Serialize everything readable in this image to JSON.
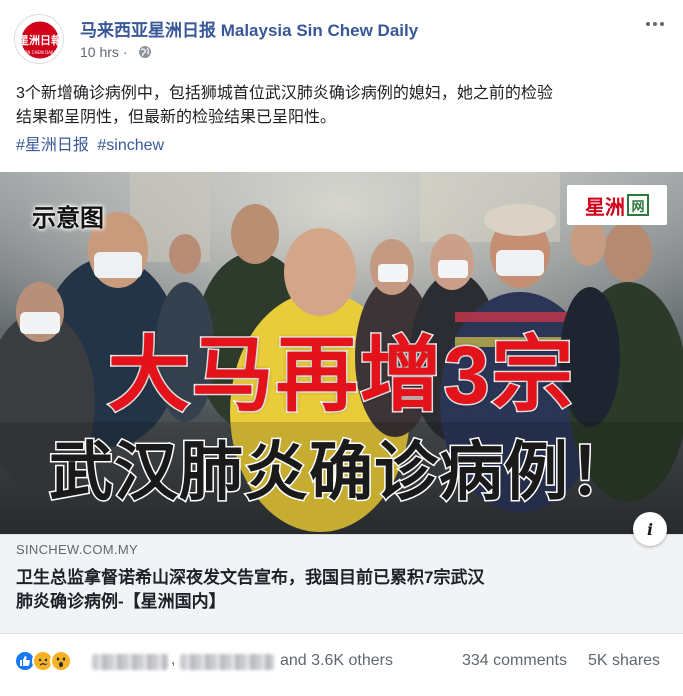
{
  "post": {
    "page_name": "马来西亚星洲日报 Malaysia Sin Chew Daily",
    "time": "10 hrs",
    "separator": "·",
    "text_line1": "3个新增确诊病例中，包括狮城首位武汉肺炎确诊病例的媳妇，她之前的检验",
    "text_line2": "结果都呈阴性，但最新的检验结果已呈阳性。",
    "hashtags": [
      "#星洲日报",
      "#sinchew"
    ],
    "icons": {
      "privacy": "globe-icon",
      "more": "more-options-icon"
    }
  },
  "image": {
    "tag_label": "示意图",
    "brand_text": "星洲",
    "brand_mark": "网",
    "headline_main": "大马再增3宗",
    "headline_sub": "武汉肺炎确诊病例！",
    "colors": {
      "headline_red": "#e4131b",
      "brand_green": "#2c7a3a"
    }
  },
  "link": {
    "info_symbol": "i",
    "domain": "SINCHEW.COM.MY",
    "title_line1": "卫生总监拿督诺希山深夜发文告宣布，我国目前已累积7宗武汉",
    "title_line2": "肺炎确诊病例-【星洲国内】"
  },
  "engagement": {
    "reaction_types": [
      "like",
      "sad",
      "wow"
    ],
    "separator": ",",
    "others_text": "and 3.6K others",
    "comments": "334 comments",
    "shares": "5K shares"
  }
}
